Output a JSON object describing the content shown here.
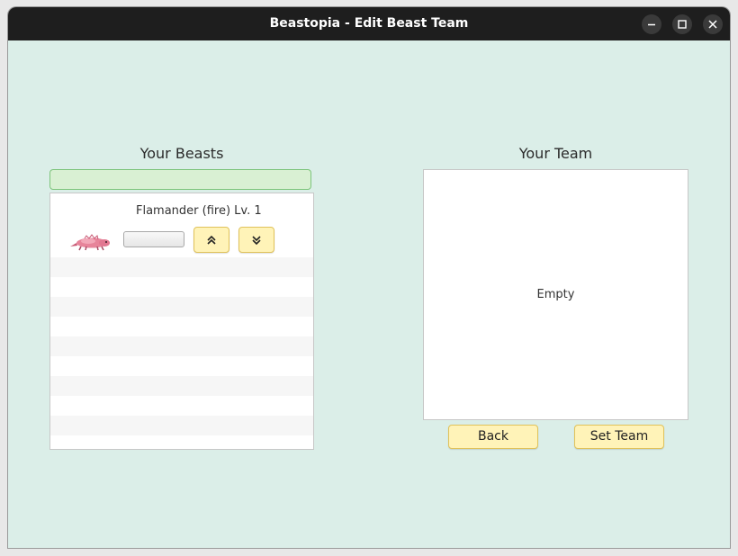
{
  "window": {
    "title": "Beastopia - Edit Beast Team",
    "controls": [
      "minimize-icon",
      "maximize-icon",
      "close-icon"
    ]
  },
  "beasts_panel": {
    "title": "Your Beasts",
    "search_value": "",
    "items": [
      {
        "label": "Flamander (fire) Lv. 1",
        "nickname_value": "",
        "sprite": "flamander-sprite"
      }
    ],
    "move_up_icon": "double-chevron-up-icon",
    "move_down_icon": "double-chevron-down-icon"
  },
  "team_panel": {
    "title": "Your Team",
    "empty_text": "Empty"
  },
  "buttons": {
    "back_label": "Back",
    "set_team_label": "Set Team"
  },
  "colors": {
    "background": "#dbeee8",
    "titlebar": "#1e1e1e",
    "button_fill": "#fff3b8",
    "button_border": "#e0c25a",
    "search_fill": "#d9f0d3",
    "search_border": "#7dc47b"
  }
}
